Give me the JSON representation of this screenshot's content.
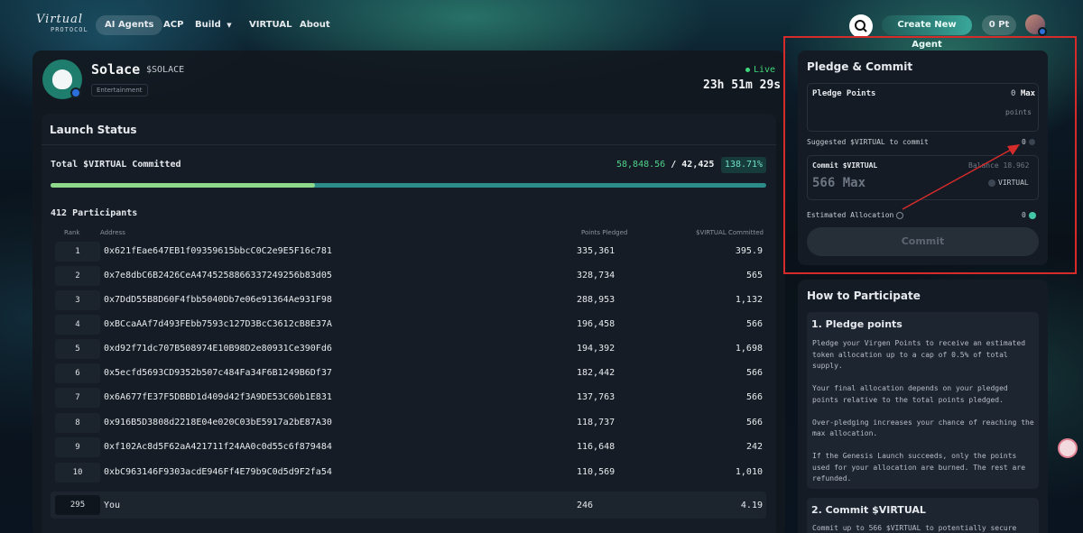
{
  "nav": {
    "logo_script": "Virtual",
    "logo_sub": "PROTOCOL",
    "items": [
      "AI Agents",
      "ACP",
      "Build",
      "VIRTUAL",
      "About"
    ],
    "create_label": "Create New Agent",
    "points_label": "0 Pt"
  },
  "agent": {
    "name": "Solace",
    "ticker": "$SOLACE",
    "tag": "Entertainment",
    "live_label": "Live",
    "timer": "23h 51m 29s"
  },
  "launch": {
    "title": "Launch Status",
    "total_label": "Total $VIRTUAL Committed",
    "committed": "58,848.56",
    "separator": "/",
    "target": "42,425",
    "percent_label": "138.71%",
    "progress_fraction": 0.37,
    "participants_label": "412 Participants",
    "columns": [
      "Rank",
      "Address",
      "Points Pledged",
      "$VIRTUAL Committed"
    ],
    "rows": [
      {
        "rank": "1",
        "address": "0x621fEae647EB1f09359615bbcC0C2e9E5F16c781",
        "points": "335,361",
        "virtual": "395.9"
      },
      {
        "rank": "2",
        "address": "0x7e8dbC6B2426CeA4745258866337249256b83d05",
        "points": "328,734",
        "virtual": "565"
      },
      {
        "rank": "3",
        "address": "0x7DdD55B8D60F4fbb5040Db7e06e91364Ae931F98",
        "points": "288,953",
        "virtual": "1,132"
      },
      {
        "rank": "4",
        "address": "0xBCcaAAf7d493FEbb7593c127D3BcC3612cB8E37A",
        "points": "196,458",
        "virtual": "566"
      },
      {
        "rank": "5",
        "address": "0xd92f71dc707B508974E10B98D2e80931Ce390Fd6",
        "points": "194,392",
        "virtual": "1,698"
      },
      {
        "rank": "6",
        "address": "0x5ecfd5693CD9352b507c484Fa34F6B1249B6Df37",
        "points": "182,442",
        "virtual": "566"
      },
      {
        "rank": "7",
        "address": "0x6A677fE37F5DBBD1d409d42f3A9DE53C60b1E831",
        "points": "137,763",
        "virtual": "566"
      },
      {
        "rank": "8",
        "address": "0x916B5D3808d2218E04e020C03bE5917a2bE87A30",
        "points": "118,737",
        "virtual": "566"
      },
      {
        "rank": "9",
        "address": "0xf102Ac8d5F62aA421711f24AA0c0d55c6f879484",
        "points": "116,648",
        "virtual": "242"
      },
      {
        "rank": "10",
        "address": "0xbC963146F9303acdE946Ff4E79b9C0d5d9F2fa54",
        "points": "110,569",
        "virtual": "1,010"
      }
    ],
    "you": {
      "rank": "295",
      "address": "You",
      "points": "246",
      "virtual": "4.19"
    }
  },
  "pledge": {
    "title": "Pledge & Commit",
    "pledge_label": "Pledge Points",
    "pledge_value": "0",
    "max_label": "Max",
    "pledge_unit": "points",
    "suggested_label": "Suggested $VIRTUAL to commit",
    "suggested_value": "0",
    "commit_label": "Commit $VIRTUAL",
    "balance_label": "Balance 18.962",
    "commit_placeholder": "566 Max",
    "token_label": "VIRTUAL",
    "est_label": "Estimated Allocation",
    "est_value": "0",
    "commit_button": "Commit"
  },
  "how": {
    "title": "How to Participate",
    "step1_title": "1. Pledge points",
    "step1_paragraphs": [
      "Pledge your Virgen Points to receive an estimated token allocation up to a cap of 0.5% of total supply.",
      "Your final allocation depends on your pledged points relative to the total points pledged.",
      "Over-pledging increases your chance of reaching the max allocation.",
      "If the Genesis Launch succeeds, only the points used for your allocation are burned. The rest are refunded."
    ],
    "step2_title": "2. Commit $VIRTUAL",
    "step2_text": "Commit up to 566 $VIRTUAL to potentially secure"
  },
  "colors": {
    "accent_green": "#4ed28a",
    "accent_teal": "#2b8c8a",
    "highlight_red": "#d52b2b",
    "badge_blue": "#2b6fdc"
  }
}
